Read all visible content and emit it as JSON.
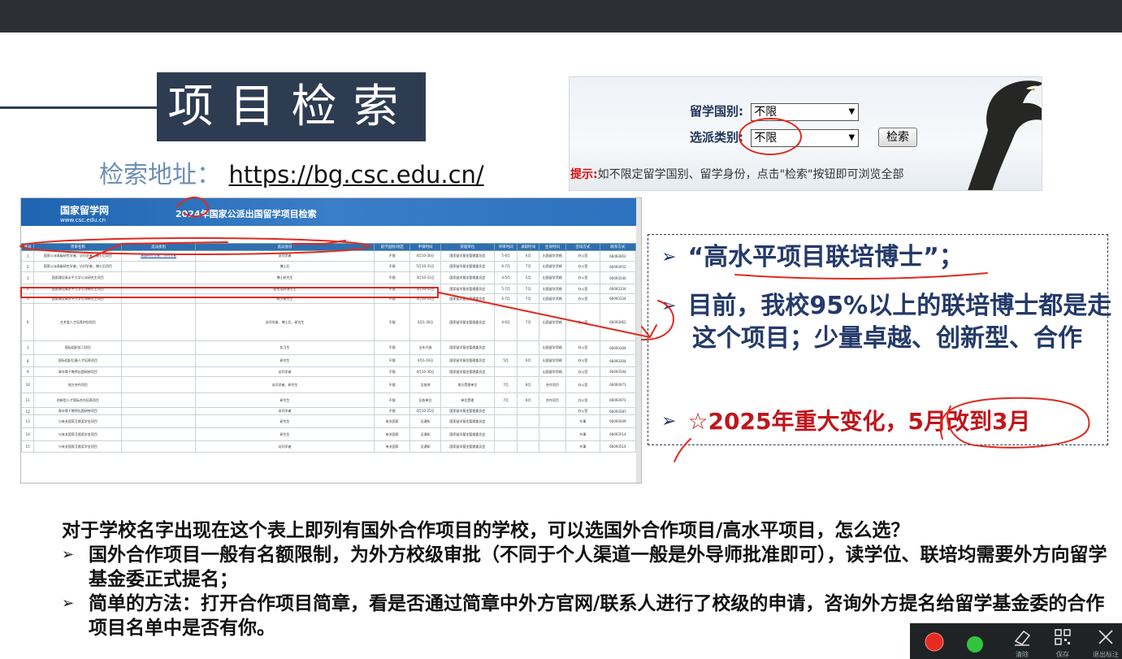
{
  "slide": {
    "title": "项目检索",
    "url_label": "检索地址：",
    "url": "https://bg.csc.edu.cn/"
  },
  "search_panel": {
    "country_label": "留学国别:",
    "country_value": "不限",
    "type_label": "选派类别:",
    "type_value": "不限",
    "search_button": "检索",
    "tip_prefix": "提示:",
    "tip_text": "如不限定留学国别、留学身份，点击\"检索\"按钮即可浏览全部"
  },
  "table_shot": {
    "logo_name": "国家留学网",
    "logo_url": "www.csc.edu.cn",
    "title": "2024年国家公派出国留学项目检索",
    "columns": [
      "序号",
      "项目名称",
      "选派类别",
      "选派身份",
      "留学国别/地区",
      "申请时间",
      "受理单位",
      "评审时间",
      "录取时间",
      "生效时间",
      "咨询方式",
      "联系方式"
    ],
    "rows": [
      [
        "1",
        "国家公派高级研究学者、访问学者、博士后项目",
        "高级研究学者、访问学者",
        "访问学者",
        "不限",
        "4月10-30日",
        "国家留学基金管理委员会",
        "5-6月",
        "6月",
        "出国留学资格",
        "办公室",
        "66093952"
      ],
      [
        "2",
        "国家公派高级研究学者、访问学者、博士后项目",
        "",
        "博士后",
        "不限",
        "5月10-31日",
        "国家留学基金管理委员会",
        "6-7月",
        "7月",
        "出国留学资格",
        "办公室",
        "66093952"
      ],
      [
        "3",
        "国家建设高水平大学公派研究生项目",
        "",
        "博士研究生",
        "不限",
        "3月10-31日",
        "国家留学基金管理委员会",
        "4-5月",
        "5月",
        "出国留学资格",
        "办公室",
        "66093540"
      ],
      [
        "4",
        "国家建设高水平大学公派研究生项目",
        "",
        "联合培养博士生",
        "不限",
        "3月10-31日",
        "国家留学基金管理委员会",
        "5-7月",
        "7月",
        "出国留学资格",
        "办公室",
        "66093334"
      ],
      [
        "5",
        "国家建设高水平大学公派研究生项目",
        "",
        "硕士研究生",
        "不限",
        "3月10-31日",
        "国家留学基金管理委员会",
        "6-7月",
        "7月",
        "出国留学资格",
        "办公室",
        "66093334"
      ],
      [
        "6",
        "艺术类人才培养特别项目",
        "",
        "访问学者、博士后、研究生",
        "不限",
        "4月1-30日",
        "国家留学基金管理委员会",
        "4-6月",
        "7月",
        "出国留学资格",
        "办公室",
        "66093062"
      ],
      [
        "7",
        "国际组织实习项目",
        "",
        "实习生",
        "不限",
        "全年开放",
        "国家留学基金管理委员会",
        "",
        "",
        "出国留学资格",
        "办公室",
        "66093304"
      ],
      [
        "8",
        "国际组织后备人才培养项目",
        "",
        "研究生",
        "不限",
        "4月1-10日",
        "国家留学基金管理委员会",
        "5月",
        "6月",
        "出国留学资格",
        "办公室",
        "66093304"
      ],
      [
        "9",
        "青年骨干教师出国研修项目",
        "",
        "访问学者",
        "不限",
        "4月10-30日",
        "国家留学基金管理委员会",
        "",
        "",
        "出国留学资格",
        "办公室",
        "66093504"
      ],
      [
        "10",
        "地方合作项目",
        "",
        "访问学者、研究生",
        "不限",
        "见各地",
        "地方受理单位",
        "7月",
        "8月",
        "合作项目",
        "办公室",
        "66093973"
      ],
      [
        "11",
        "创新型人才国际合作培养项目",
        "",
        "研究生",
        "不限",
        "见各单位",
        "单位受理",
        "7月",
        "8月",
        "合作项目",
        "办公室",
        "66093973"
      ],
      [
        "12",
        "青年骨干教师出国研修项目",
        "",
        "访问学者",
        "不限",
        "4月10-25日",
        "国家留学基金管理委员会",
        "",
        "",
        "",
        "办公室",
        "66093587"
      ],
      [
        "13",
        "与有关国家互换奖学金项目",
        "",
        "研究生",
        "有关国家",
        "见通知",
        "国家留学基金管理委员会",
        "",
        "",
        "",
        "外事",
        "66093049"
      ],
      [
        "14",
        "与有关国家互换奖学金项目",
        "",
        "研究生",
        "有关国家",
        "见通知",
        "国家留学基金管理委员会",
        "",
        "",
        "",
        "外事",
        "66093514"
      ],
      [
        "15",
        "与有关国家互换奖学金项目",
        "",
        "访问学者",
        "有关国家",
        "见通知",
        "国家留学基金管理委员会",
        "",
        "",
        "",
        "外事",
        "66093514"
      ]
    ]
  },
  "bullets": [
    {
      "text": "“高水平项目联培博士”；",
      "color": "#243a6a"
    },
    {
      "text": "目前，我校95%以上的联培博士都是走这个项目；少量卓越、创新型、合作",
      "color": "#243a6a"
    },
    {
      "text": "☆2025年重大变化，5月改到3月",
      "color": "#c0161c"
    }
  ],
  "bottom": {
    "question": "对于学校名字出现在这个表上即列有国外合作项目的学校，可以选国外合作项目/高水平项目，怎么选？",
    "items": [
      "国外合作项目一般有名额限制，为外方校级审批（不同于个人渠道一般是外导师批准即可），读学位、联培均需要外方向留学基金委正式提名；",
      "简单的方法：打开合作项目简章，看是否通过简章中外方官网/联系人进行了校级的申请，咨询外方提名给留学基金委的合作项目名单中是否有你。"
    ]
  },
  "toolbar": {
    "clear_label": "清除",
    "save_label": "保存",
    "exit_label": "退出标注"
  },
  "colors": {
    "title_bg": "#2e3c52",
    "accent_red": "#c0161c",
    "annotation_red": "#e02a20",
    "text_blue": "#243a6a"
  }
}
